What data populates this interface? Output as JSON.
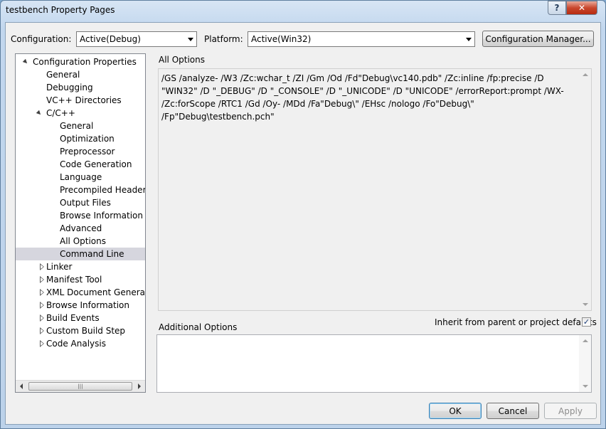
{
  "window": {
    "title": "testbench Property Pages",
    "help_glyph": "?",
    "close_glyph": "✕"
  },
  "toolbar": {
    "configuration_label": "Configuration:",
    "configuration_value": "Active(Debug)",
    "platform_label": "Platform:",
    "platform_value": "Active(Win32)",
    "config_manager_label": "Configuration Manager..."
  },
  "tree": {
    "items": [
      {
        "label": "Configuration Properties",
        "level": 0,
        "expander": "open"
      },
      {
        "label": "General",
        "level": 1,
        "expander": "none"
      },
      {
        "label": "Debugging",
        "level": 1,
        "expander": "none"
      },
      {
        "label": "VC++ Directories",
        "level": 1,
        "expander": "none"
      },
      {
        "label": "C/C++",
        "level": 1,
        "expander": "open"
      },
      {
        "label": "General",
        "level": 2,
        "expander": "none"
      },
      {
        "label": "Optimization",
        "level": 2,
        "expander": "none"
      },
      {
        "label": "Preprocessor",
        "level": 2,
        "expander": "none"
      },
      {
        "label": "Code Generation",
        "level": 2,
        "expander": "none"
      },
      {
        "label": "Language",
        "level": 2,
        "expander": "none"
      },
      {
        "label": "Precompiled Headers",
        "level": 2,
        "expander": "none"
      },
      {
        "label": "Output Files",
        "level": 2,
        "expander": "none"
      },
      {
        "label": "Browse Information",
        "level": 2,
        "expander": "none"
      },
      {
        "label": "Advanced",
        "level": 2,
        "expander": "none"
      },
      {
        "label": "All Options",
        "level": 2,
        "expander": "none"
      },
      {
        "label": "Command Line",
        "level": 2,
        "expander": "none",
        "selected": true
      },
      {
        "label": "Linker",
        "level": 1,
        "expander": "closed"
      },
      {
        "label": "Manifest Tool",
        "level": 1,
        "expander": "closed"
      },
      {
        "label": "XML Document Generator",
        "level": 1,
        "expander": "closed"
      },
      {
        "label": "Browse Information",
        "level": 1,
        "expander": "closed"
      },
      {
        "label": "Build Events",
        "level": 1,
        "expander": "closed"
      },
      {
        "label": "Custom Build Step",
        "level": 1,
        "expander": "closed"
      },
      {
        "label": "Code Analysis",
        "level": 1,
        "expander": "closed"
      }
    ],
    "hscroll_thumb_grip": "|||"
  },
  "main": {
    "all_options_label": "All Options",
    "all_options_text": "/GS /analyze- /W3 /Zc:wchar_t /ZI /Gm /Od /Fd\"Debug\\vc140.pdb\" /Zc:inline /fp:precise /D \"WIN32\" /D \"_DEBUG\" /D \"_CONSOLE\" /D \"_UNICODE\" /D \"UNICODE\" /errorReport:prompt /WX- /Zc:forScope /RTC1 /Gd /Oy- /MDd /Fa\"Debug\\\" /EHsc /nologo /Fo\"Debug\\\" /Fp\"Debug\\testbench.pch\"",
    "inherit_label": "Inherit from parent or project defaults",
    "inherit_checked": true,
    "check_glyph": "✓",
    "additional_options_label": "Additional Options",
    "additional_options_value": ""
  },
  "footer": {
    "ok_label": "OK",
    "cancel_label": "Cancel",
    "apply_label": "Apply"
  }
}
